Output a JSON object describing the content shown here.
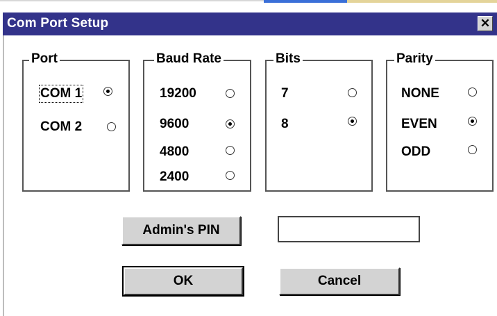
{
  "dialog": {
    "title": "Com Port Setup",
    "close_label": "✕"
  },
  "port": {
    "title": "Port",
    "options": [
      {
        "label": "COM 1",
        "selected": true
      },
      {
        "label": "COM 2",
        "selected": false
      }
    ]
  },
  "baud": {
    "title": "Baud Rate",
    "options": [
      {
        "label": "19200",
        "selected": false
      },
      {
        "label": "9600",
        "selected": true
      },
      {
        "label": "4800",
        "selected": false
      },
      {
        "label": "2400",
        "selected": false
      }
    ]
  },
  "bits": {
    "title": "Bits",
    "options": [
      {
        "label": "7",
        "selected": false
      },
      {
        "label": "8",
        "selected": true
      }
    ]
  },
  "parity": {
    "title": "Parity",
    "options": [
      {
        "label": "NONE",
        "selected": false
      },
      {
        "label": "EVEN",
        "selected": true
      },
      {
        "label": "ODD",
        "selected": false
      }
    ]
  },
  "admin": {
    "button_label": "Admin's PIN",
    "pin_value": ""
  },
  "actions": {
    "ok_label": "OK",
    "cancel_label": "Cancel"
  }
}
